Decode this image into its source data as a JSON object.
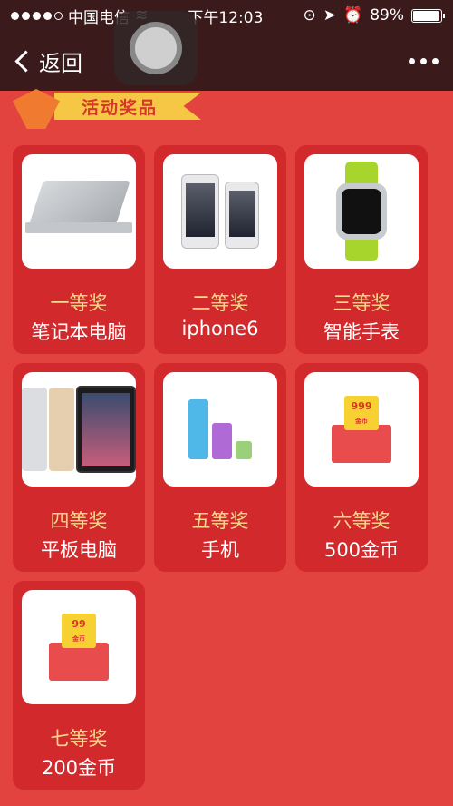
{
  "status_bar": {
    "carrier": "中国电信",
    "time": "下午12:03",
    "battery": "89%",
    "battery_level": 0.89
  },
  "nav": {
    "back_label": "返回"
  },
  "section": {
    "title": "活动奖品"
  },
  "prizes": [
    {
      "tier": "一等奖",
      "name": "笔记本电脑",
      "icon": "laptop"
    },
    {
      "tier": "二等奖",
      "name": "iphone6",
      "icon": "iphone"
    },
    {
      "tier": "三等奖",
      "name": "智能手表",
      "icon": "smartwatch"
    },
    {
      "tier": "四等奖",
      "name": "平板电脑",
      "icon": "tablet"
    },
    {
      "tier": "五等奖",
      "name": "手机",
      "icon": "mp3-player"
    },
    {
      "tier": "六等奖",
      "name": "500金币",
      "icon": "red-envelope",
      "coin_amount": "999"
    },
    {
      "tier": "七等奖",
      "name": "200金币",
      "icon": "red-envelope",
      "coin_amount": "99"
    }
  ],
  "colors": {
    "background": "#e3433f",
    "card": "#d2292d",
    "tier_text": "#f5d98a",
    "nav": "#3a1a1a"
  }
}
